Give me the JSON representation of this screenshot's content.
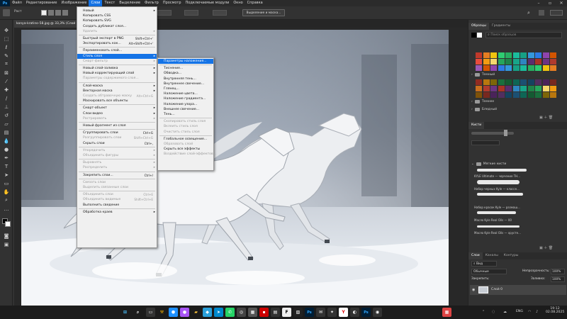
{
  "menubar": {
    "logo": "Ps",
    "items": [
      "Файл",
      "Редактирование",
      "Изображение",
      "Слои",
      "Текст",
      "Выделение",
      "Фильтр",
      "Просмотр",
      "Подключаемые модули",
      "Окно",
      "Справка"
    ],
    "active_index": 3
  },
  "optionsbar": {
    "mask_button": "Выделение и маска..."
  },
  "document": {
    "tab_title": "konya-kratino-58.jpg @ 33,3% (Слой 0, RGB/8#) *"
  },
  "layers_menu": [
    {
      "label": "Новый",
      "arrow": true
    },
    {
      "label": "Копировать CSS"
    },
    {
      "label": "Копировать SVG"
    },
    {
      "label": "Создать дубликат слоя..."
    },
    {
      "label": "Удалить",
      "arrow": true,
      "disabled": true
    },
    {
      "sep": true
    },
    {
      "label": "Быстрый экспорт в PNG",
      "shortcut": "Shift+Ctrl+'"
    },
    {
      "label": "Экспортировать как...",
      "shortcut": "Alt+Shift+Ctrl+'"
    },
    {
      "sep": true
    },
    {
      "label": "Переименовать слой..."
    },
    {
      "label": "Стиль слоя",
      "arrow": true,
      "highlight": true
    },
    {
      "label": "Смарт-фильтр",
      "arrow": true,
      "disabled": true
    },
    {
      "sep": true
    },
    {
      "label": "Новый слой-заливка",
      "arrow": true
    },
    {
      "label": "Новый корректирующий слой",
      "arrow": true
    },
    {
      "label": "Параметры содержимого слоя...",
      "disabled": true
    },
    {
      "sep": true
    },
    {
      "label": "Слой-маска",
      "arrow": true
    },
    {
      "label": "Векторная маска",
      "arrow": true
    },
    {
      "label": "Создать обтравочную маску",
      "shortcut": "Alt+Ctrl+G",
      "disabled": true
    },
    {
      "label": "Маскировать все объекты"
    },
    {
      "sep": true
    },
    {
      "label": "Смарт-объект",
      "arrow": true
    },
    {
      "label": "Слои видео",
      "arrow": true
    },
    {
      "label": "Растрировать",
      "arrow": true,
      "disabled": true
    },
    {
      "sep": true
    },
    {
      "label": "Новый фрагмент из слоя"
    },
    {
      "sep": true
    },
    {
      "label": "Сгруппировать слои",
      "shortcut": "Ctrl+G"
    },
    {
      "label": "Разгруппировать слои",
      "shortcut": "Shift+Ctrl+G",
      "disabled": true
    },
    {
      "label": "Скрыть слои",
      "shortcut": "Ctrl+,"
    },
    {
      "sep": true
    },
    {
      "label": "Упорядочить",
      "arrow": true,
      "disabled": true
    },
    {
      "label": "Объединить фигуры",
      "arrow": true,
      "disabled": true
    },
    {
      "sep": true
    },
    {
      "label": "Выровнять",
      "arrow": true,
      "disabled": true
    },
    {
      "label": "Распределить",
      "arrow": true,
      "disabled": true
    },
    {
      "sep": true
    },
    {
      "label": "Закрепить слои...",
      "shortcut": "Ctrl+/"
    },
    {
      "sep": true
    },
    {
      "label": "Связать слои",
      "disabled": true
    },
    {
      "label": "Выделить связанные слои",
      "disabled": true
    },
    {
      "sep": true
    },
    {
      "label": "Объединить слои",
      "shortcut": "Ctrl+E",
      "disabled": true
    },
    {
      "label": "Объединить видимые",
      "shortcut": "Shift+Ctrl+E",
      "disabled": true
    },
    {
      "label": "Выполнить сведение"
    },
    {
      "sep": true
    },
    {
      "label": "Обработка краев",
      "arrow": true
    }
  ],
  "style_submenu": [
    {
      "label": "Параметры наложения...",
      "highlight": true
    },
    {
      "sep": true
    },
    {
      "label": "Тиснение..."
    },
    {
      "label": "Обводка..."
    },
    {
      "label": "Внутренняя тень..."
    },
    {
      "label": "Внутреннее свечение..."
    },
    {
      "label": "Глянец..."
    },
    {
      "label": "Наложение цвета..."
    },
    {
      "label": "Наложение градиента..."
    },
    {
      "label": "Наложение узора..."
    },
    {
      "label": "Внешнее свечение..."
    },
    {
      "label": "Тень..."
    },
    {
      "sep": true
    },
    {
      "label": "Скопировать стиль слоя",
      "disabled": true
    },
    {
      "label": "Вклеить стиль слоя",
      "disabled": true
    },
    {
      "label": "Очистить стиль слоя",
      "disabled": true
    },
    {
      "sep": true
    },
    {
      "label": "Глобальное освещение..."
    },
    {
      "label": "Образовать слой",
      "disabled": true
    },
    {
      "label": "Скрыть все эффекты"
    },
    {
      "label": "Воздействие слой-эффектов...",
      "disabled": true
    }
  ],
  "swatches_panel": {
    "tabs": [
      "Образцы",
      "Градиенты"
    ],
    "search_placeholder": "Поиск образцов",
    "groups": [
      "Темный",
      "Темнее",
      "Бледный"
    ]
  },
  "brushes_panel": {
    "tab": "Кисти",
    "group": "Мягкие кисти",
    "brushes": [
      "KYLE Ultimate — черчение ТН...",
      "Набор черных Kyle — классе...",
      "Набор красок Kyle — размаш...",
      "Масло Kyle Real Oils — 00",
      "Масло Kyle Real Oils — хрусте..."
    ]
  },
  "layers_panel": {
    "tabs": [
      "Слои",
      "Каналы",
      "Контуры"
    ],
    "filter": "Вид",
    "blend_mode": "Обычные",
    "opacity_label": "Непрозрачность:",
    "opacity": "100%",
    "lock_label": "Закрепить:",
    "fill_label": "Заливка:",
    "fill": "100%",
    "layer_name": "Слой 0"
  },
  "taskbar": {
    "lang": "ENG",
    "time": "19:12",
    "date": "02.08.2025"
  },
  "colors": {
    "accent": "#1473e6",
    "menu_bg": "#f0f0f0"
  }
}
